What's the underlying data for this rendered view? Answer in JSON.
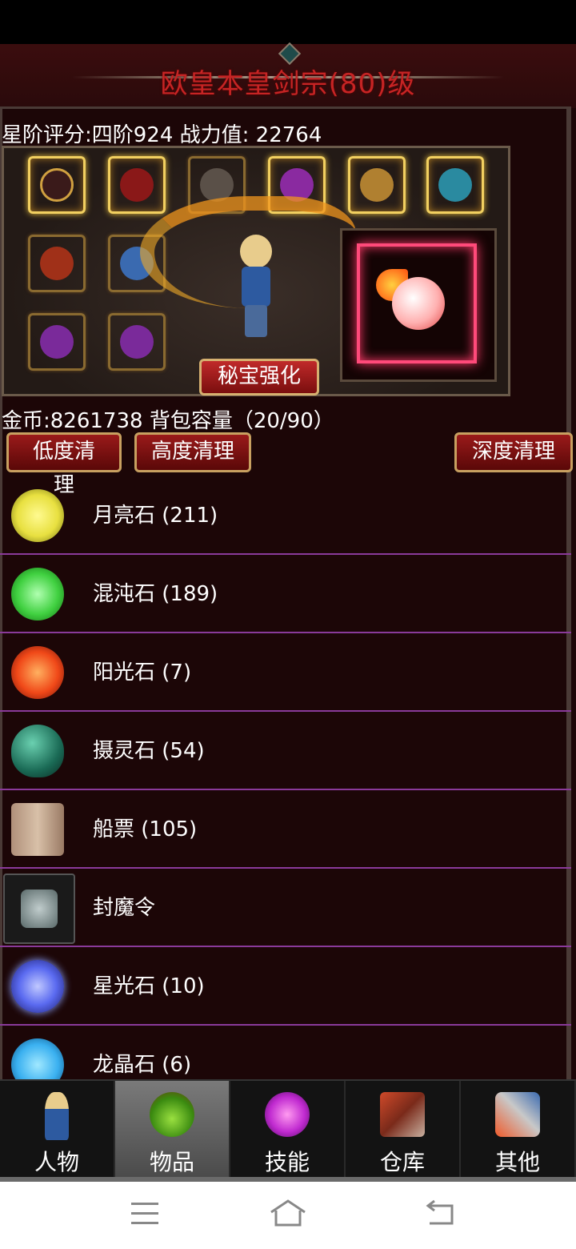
{
  "title": "欧皇本皇剑宗(80)级",
  "stats": {
    "text": "星阶评分:四阶924 战力值:  22764"
  },
  "equip": {
    "enhance_label": "秘宝强化"
  },
  "bag": {
    "text": "金币:8261738 背包容量（20/90）"
  },
  "clean_buttons": {
    "low": "低度清理",
    "high": "高度清理",
    "deep": "深度清理"
  },
  "items": [
    {
      "name": "月亮石 (211)",
      "icon": "moonstone-icon",
      "color": "#e8e040"
    },
    {
      "name": "混沌石 (189)",
      "icon": "chaos-stone-icon",
      "color": "#40d040"
    },
    {
      "name": "阳光石 (7)",
      "icon": "sunstone-icon",
      "color": "#f04818"
    },
    {
      "name": "摄灵石 (54)",
      "icon": "soul-stone-icon",
      "color": "#2a8a70"
    },
    {
      "name": "船票 (105)",
      "icon": "ship-ticket-icon",
      "color": "#c0a088"
    },
    {
      "name": "封魔令",
      "icon": "seal-token-icon",
      "color": "#8a9a9a"
    },
    {
      "name": "星光石 (10)",
      "icon": "starlight-stone-icon",
      "color": "#5a6af0"
    },
    {
      "name": "龙晶石 (6)",
      "icon": "dragon-crystal-icon",
      "color": "#3ab0f0"
    }
  ],
  "tabs": [
    {
      "label": "人物",
      "icon": "character-icon",
      "active": false
    },
    {
      "label": "物品",
      "icon": "potion-icon",
      "active": true
    },
    {
      "label": "技能",
      "icon": "skill-orb-icon",
      "active": false
    },
    {
      "label": "仓库",
      "icon": "warehouse-icon",
      "active": false
    },
    {
      "label": "其他",
      "icon": "misc-icon",
      "active": false
    }
  ]
}
